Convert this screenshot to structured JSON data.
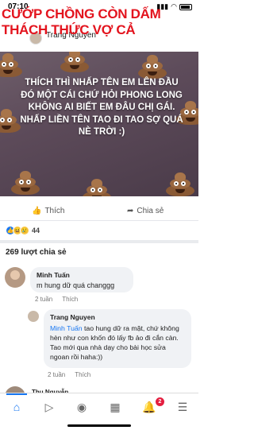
{
  "status_bar": {
    "time": "07:10"
  },
  "overlay_title": {
    "line1": "CƯỚP CHỒNG CÒN DẤM",
    "line2": "THÁCH THỨC VỢ CẢ"
  },
  "post": {
    "author": "Trang Nguyen",
    "image_text": "THÍCH THÌ NHẤP TÊN EM LÊN ĐẦU ĐÓ MỘT CÁI CHỨ HỎI PHONG LONG KHÔNG AI BIẾT EM ĐÂU CHỊ GÁI. NHẤP LIỀN TÊN TAO ĐI TAO SỢ QUÁ NÈ TRỜI :)",
    "like_label": "Thích",
    "share_label": "Chia sẻ",
    "reaction_count": "44",
    "shares_text": "269 lượt chia sẻ"
  },
  "comments": [
    {
      "name": "Minh Tuấn",
      "text": "m hung dữ quá changgg",
      "time": "2 tuần",
      "like": "Thích"
    },
    {
      "name": "Trang Nguyen",
      "mention": "Minh Tuấn",
      "text": " tao hung dữ ra mặt, chứ không hèn như con khốn đó lấy fb ảo đi cắn càn. Tao mới qua nhà dạy cho bài học sửa ngoan rồi haha:))",
      "time": "2 tuần",
      "like": "Thích"
    },
    {
      "name": "Thu Nguyễn"
    }
  ],
  "tabbar": {
    "notification_badge": "2",
    "active_tab": "home"
  },
  "colors": {
    "title_red": "#e3141e",
    "facebook_blue": "#1877f2",
    "image_bg": "#5d4b5a"
  }
}
